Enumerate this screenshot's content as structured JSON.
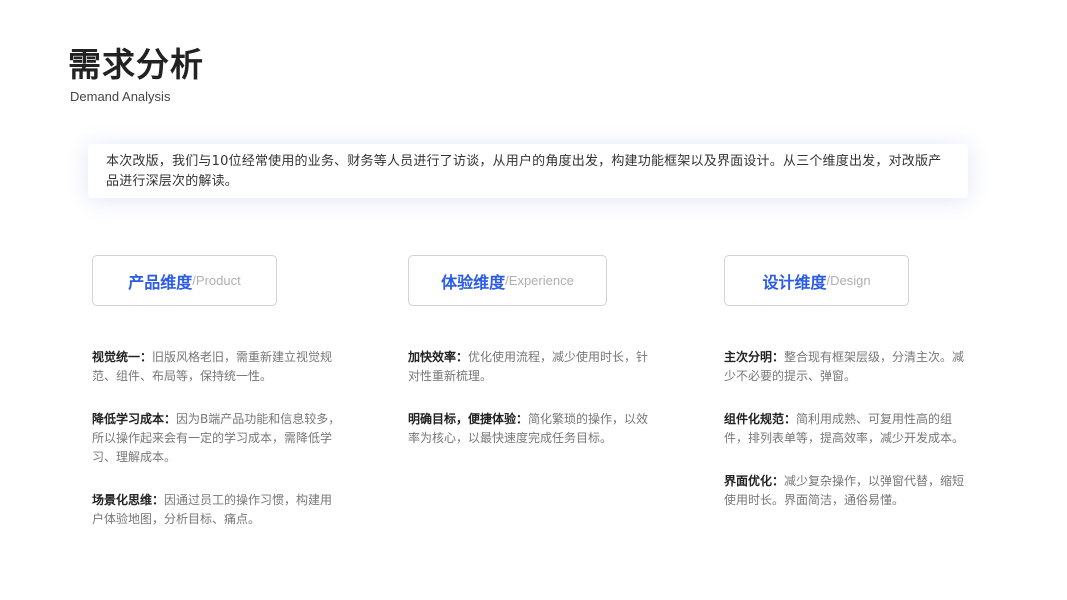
{
  "header": {
    "title": "需求分析",
    "subtitle": "Demand Analysis"
  },
  "intro": {
    "text": "本次改版，我们与10位经常使用的业务、财务等人员进行了访谈，从用户的角度出发，构建功能框架以及界面设计。从三个维度出发，对改版产品进行深层次的解读。"
  },
  "columns": [
    {
      "tag_main": "产品维度",
      "tag_sub": "/Product",
      "items": [
        {
          "title": "视觉统一：",
          "text": "旧版风格老旧，需重新建立视觉规范、组件、布局等，保持统一性。"
        },
        {
          "title": "降低学习成本：",
          "text": "因为B端产品功能和信息较多，所以操作起来会有一定的学习成本，需降低学习、理解成本。"
        },
        {
          "title": "场景化思维：",
          "text": "因通过员工的操作习惯，构建用户体验地图，分析目标、痛点。"
        }
      ]
    },
    {
      "tag_main": "体验维度",
      "tag_sub": "/Experience",
      "items": [
        {
          "title": "加快效率：",
          "text": "优化使用流程，减少使用时长，针对性重新梳理。"
        },
        {
          "title": "明确目标，便捷体验：",
          "text": "简化繁琐的操作，以效率为核心，以最快速度完成任务目标。"
        }
      ]
    },
    {
      "tag_main": "设计维度",
      "tag_sub": "/Design",
      "items": [
        {
          "title": "主次分明：",
          "text": "整合现有框架层级，分清主次。减少不必要的提示、弹窗。"
        },
        {
          "title": "组件化规范：",
          "text": "简利用成熟、可复用性高的组件，排列表单等，提高效率，减少开发成本。"
        },
        {
          "title": "界面优化：",
          "text": "减少复杂操作，以弹窗代替，缩短使用时长。界面简洁，通俗易懂。"
        }
      ]
    }
  ],
  "colors": {
    "accent": "#2b5ce5",
    "title": "#222222",
    "body": "#777777",
    "muted": "#b0b0b0"
  }
}
